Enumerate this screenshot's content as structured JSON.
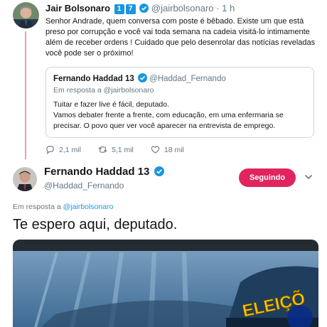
{
  "tweet1": {
    "name": "Jair Bolsonaro",
    "badge_digits": [
      "1",
      "7"
    ],
    "handle": "@jairbolsonaro",
    "time": "· 1 h",
    "text": "Senhor Andrade, quem conversa com poste é bêbado. Existe um que está preso por corrupção e você vai toda semana na cadeia visitá-lo intimamente além de receber ordens ! Cuidado que pelo desenrolar das notícias reveladas você pode ser o próximo!"
  },
  "quote": {
    "name": "Fernando Haddad 13",
    "handle": "@Haddad_Fernando",
    "reply_prefix": "Em resposta a",
    "reply_handle": "@jairbolsonaro",
    "line1": "Tuitar e fazer live é fácil, deputado.",
    "line2": "Vamos debater frente a frente, com educação, em uma enfermaria se precisar. O povo quer ver você aparecer na entrevista de emprego."
  },
  "actions": {
    "replies": "2,1 mil",
    "retweets": "5,1 mil",
    "likes": "18 mil"
  },
  "tweet2": {
    "name": "Fernando Haddad 13",
    "handle": "@Haddad_Fernando",
    "follow_label": "Seguindo",
    "reply_prefix": "Em resposta a",
    "reply_handle": "@jairbolsonaro",
    "text": "Te espero aqui, deputado.",
    "media_sign": "ELEIÇÕ"
  },
  "colors": {
    "accent": "#1b95e0",
    "follow": "#e0245e",
    "thread": "#e8a0b3"
  }
}
